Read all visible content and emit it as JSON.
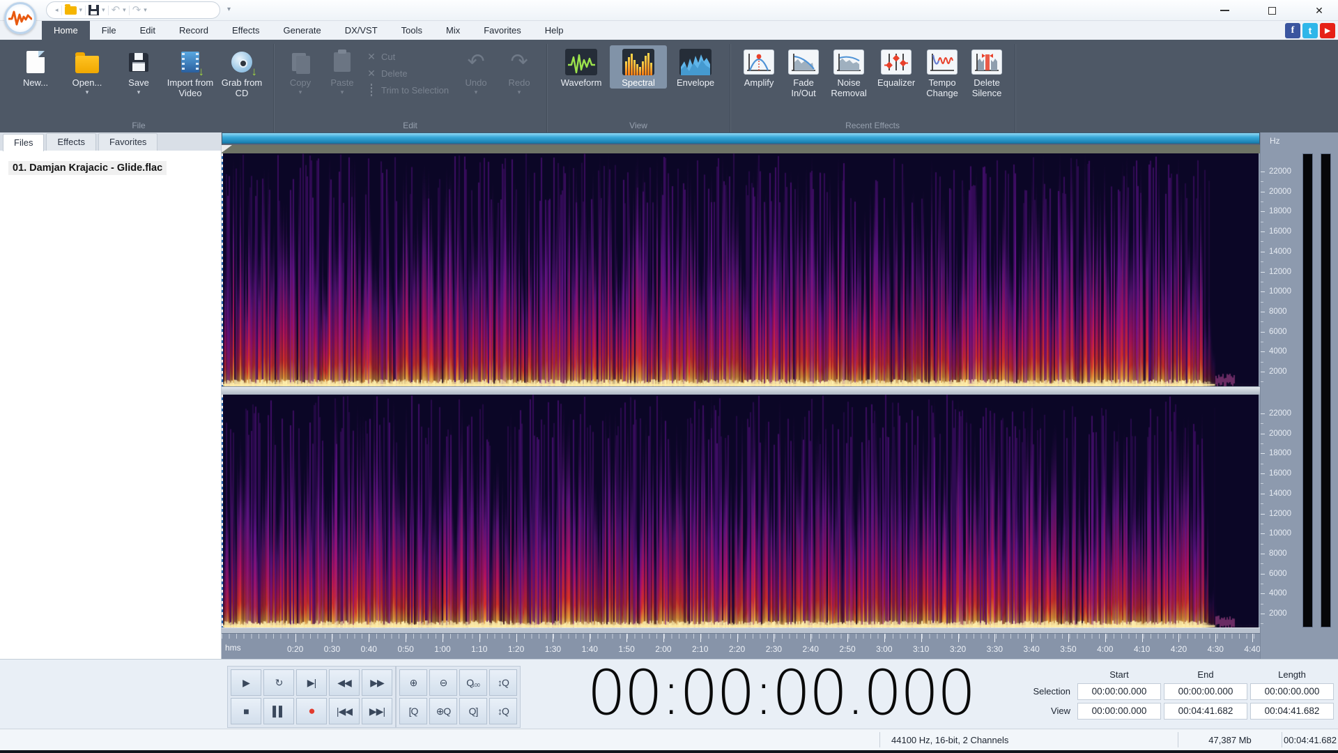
{
  "icons": {
    "dropdown": "▾",
    "undo": "↶",
    "redo": "↷",
    "cut": "✕",
    "delete": "✕",
    "close": "✕",
    "facebook": "f",
    "twitter": "t",
    "youtube_play": "▶",
    "green_download": "↓"
  },
  "menu": {
    "tabs": [
      "Home",
      "File",
      "Edit",
      "Record",
      "Effects",
      "Generate",
      "DX/VST",
      "Tools",
      "Mix",
      "Favorites",
      "Help"
    ],
    "active": "Home"
  },
  "ribbon": {
    "groups": [
      {
        "label": "File",
        "buttons": [
          {
            "label": "New...",
            "dropdown": false
          },
          {
            "label": "Open...",
            "dropdown": true
          },
          {
            "label": "Save",
            "dropdown": true
          },
          {
            "label": "Import from Video",
            "dropdown": false
          },
          {
            "label": "Grab from CD",
            "dropdown": false
          }
        ]
      },
      {
        "label": "Edit",
        "buttons": [
          {
            "label": "Copy",
            "dropdown": true,
            "disabled": true
          },
          {
            "label": "Paste",
            "dropdown": true,
            "disabled": true
          },
          {
            "label": "Cut",
            "disabled": true
          },
          {
            "label": "Delete",
            "disabled": true
          },
          {
            "label": "Trim to Selection",
            "disabled": true
          },
          {
            "label": "Undo",
            "dropdown": true,
            "disabled": true
          },
          {
            "label": "Redo",
            "dropdown": true,
            "disabled": true
          }
        ]
      },
      {
        "label": "View",
        "buttons": [
          {
            "label": "Waveform"
          },
          {
            "label": "Spectral",
            "active": true
          },
          {
            "label": "Envelope"
          }
        ]
      },
      {
        "label": "Recent Effects",
        "buttons": [
          {
            "label": "Amplify"
          },
          {
            "label": "Fade In/Out"
          },
          {
            "label": "Noise Removal"
          },
          {
            "label": "Equalizer"
          },
          {
            "label": "Tempo Change"
          },
          {
            "label": "Delete Silence"
          }
        ]
      }
    ]
  },
  "sidebar": {
    "tabs": [
      "Files",
      "Effects",
      "Favorites"
    ],
    "active": "Files",
    "files": [
      "01. Damjan Krajacic - Glide.flac"
    ]
  },
  "spectral_view": {
    "freq_unit": "Hz",
    "freq_labels": [
      "22000",
      "20000",
      "18000",
      "16000",
      "14000",
      "12000",
      "10000",
      "8000",
      "6000",
      "4000",
      "2000"
    ],
    "timeline_unit": "hms",
    "timeline_labels": [
      "0:20",
      "0:30",
      "0:40",
      "0:50",
      "1:00",
      "1:10",
      "1:20",
      "1:30",
      "1:40",
      "1:50",
      "2:00",
      "2:10",
      "2:20",
      "2:30",
      "2:40",
      "2:50",
      "3:00",
      "3:10",
      "3:20",
      "3:30",
      "3:40",
      "3:50",
      "4:00",
      "4:10",
      "4:20",
      "4:30",
      "4:40"
    ]
  },
  "transport": {
    "row1": [
      {
        "name": "play",
        "glyph": "▶"
      },
      {
        "name": "play-looped",
        "glyph": "↻"
      },
      {
        "name": "play-to-end",
        "glyph": "▶|"
      },
      {
        "name": "rewind",
        "glyph": "◀◀"
      },
      {
        "name": "fast-forward",
        "glyph": "▶▶"
      }
    ],
    "row2": [
      {
        "name": "stop",
        "glyph": "■"
      },
      {
        "name": "pause",
        "glyph": "▌▌"
      },
      {
        "name": "record",
        "glyph": "●"
      },
      {
        "name": "go-to-start",
        "glyph": "|◀◀"
      },
      {
        "name": "go-to-end",
        "glyph": "▶▶|"
      }
    ]
  },
  "zoom_controls": {
    "row1": [
      {
        "name": "zoom-in",
        "glyph": "⊕"
      },
      {
        "name": "zoom-out",
        "glyph": "⊖"
      },
      {
        "name": "zoom-100",
        "glyph": "Q",
        "sub": "100"
      },
      {
        "name": "zoom-vertical-in",
        "glyph": "↕Q"
      }
    ],
    "row2": [
      {
        "name": "zoom-to-selection-start",
        "glyph": "[Q"
      },
      {
        "name": "zoom-to-selection",
        "glyph": "⊕Q"
      },
      {
        "name": "zoom-to-selection-end",
        "glyph": "Q]"
      },
      {
        "name": "zoom-vertical-out",
        "glyph": "↕Q"
      }
    ]
  },
  "time_display": "00:00:00.000",
  "selection_grid": {
    "col_headers": [
      "Start",
      "End",
      "Length"
    ],
    "rows": [
      {
        "label": "Selection",
        "values": [
          "00:00:00.000",
          "00:00:00.000",
          "00:00:00.000"
        ]
      },
      {
        "label": "View",
        "values": [
          "00:00:00.000",
          "00:04:41.682",
          "00:04:41.682"
        ]
      }
    ]
  },
  "status_bar": {
    "format": "44100 Hz, 16-bit, 2 Channels",
    "memory": "47,387 Mb",
    "duration": "00:04:41.682"
  },
  "colors": {
    "ribbon_bg": "#4e5866",
    "scrollbar_accent": "#2e9fd0",
    "record_red": "#e23b2e",
    "spectrogram_bg": "#0b0626"
  }
}
